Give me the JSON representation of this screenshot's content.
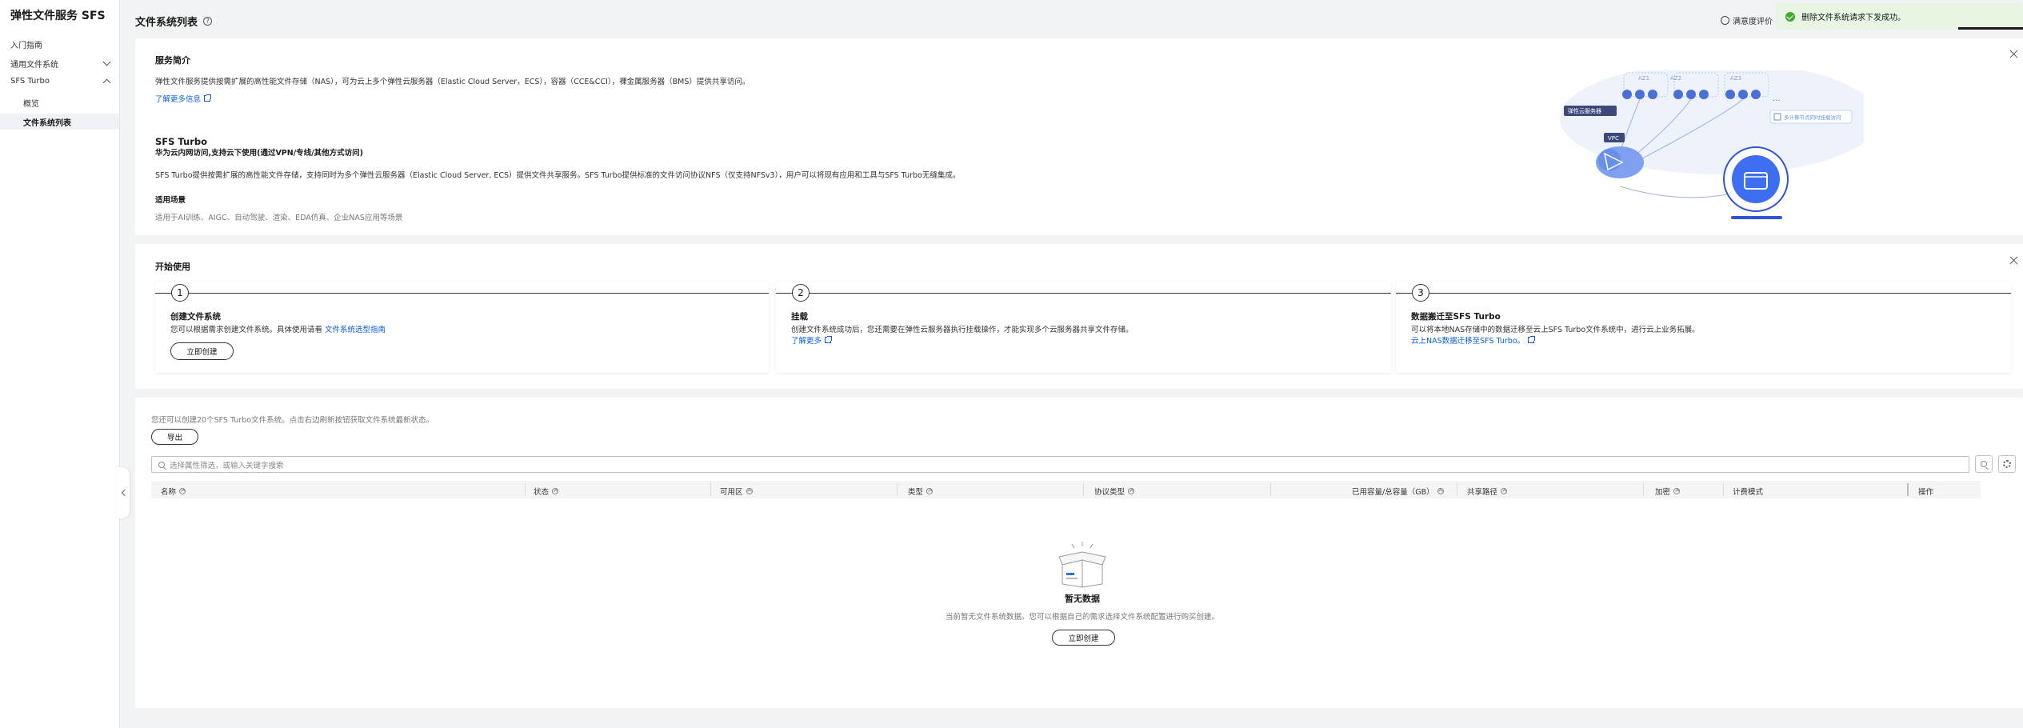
{
  "sidebar": {
    "service_title": "弹性文件服务 SFS",
    "items": [
      {
        "label": "入门指南"
      },
      {
        "label": "通用文件系统"
      },
      {
        "label": "SFS Turbo"
      }
    ],
    "sub_items": [
      {
        "label": "概览"
      },
      {
        "label": "文件系统列表"
      }
    ]
  },
  "header": {
    "title": "文件系统列表",
    "help_glyph": "?",
    "feedback_label": "满意度评价",
    "toast_text": "删除文件系统请求下发成功。"
  },
  "intro": {
    "section_title": "服务简介",
    "description": "弹性文件服务提供按需扩展的高性能文件存储（NAS），可为云上多个弹性云服务器（Elastic Cloud Server，ECS），容器（CCE&CCI），裸金属服务器（BMS）提供共享访问。",
    "learn_more": "了解更多信息",
    "turbo_title": "SFS Turbo",
    "turbo_subtitle": "华为云内网访问,支持云下使用(通过VPN/专线/其他方式访问)",
    "turbo_desc": "SFS Turbo提供按需扩展的高性能文件存储，支持同时为多个弹性云服务器（Elastic Cloud Server, ECS）提供文件共享服务。SFS Turbo提供标准的文件访问协议NFS（仅支持NFSv3），用户可以将现有应用和工具与SFS Turbo无缝集成。",
    "scenario_title": "适用场景",
    "scenario_desc": "适用于AI训练、AIGC、自动驾驶、渲染、EDA仿真、企业NAS应用等场景",
    "illustration": {
      "az_labels": [
        "AZ1",
        "AZ2",
        "AZ3"
      ],
      "ecs_label": "弹性云服务器",
      "vpc_label": "VPC",
      "node_label": "多计算节点同时挂载访问",
      "ellipsis": "..."
    }
  },
  "getting_started": {
    "section_title": "开始使用",
    "steps": [
      {
        "num": "1",
        "title": "创建文件系统",
        "desc": "您可以根据需求创建文件系统。具体使用请看",
        "link": "文件系统选型指南",
        "button": "立即创建"
      },
      {
        "num": "2",
        "title": "挂载",
        "desc": "创建文件系统成功后，您还需要在弹性云服务器执行挂载操作，才能实现多个云服务器共享文件存储。",
        "link": "了解更多"
      },
      {
        "num": "3",
        "title": "数据搬迁至SFS Turbo",
        "desc": "可以将本地NAS存储中的数据迁移至云上SFS Turbo文件系统中，进行云上业务拓展。",
        "link": "云上NAS数据迁移至SFS Turbo。"
      }
    ]
  },
  "list": {
    "quota_text": "您还可以创建20个SFS Turbo文件系统。点击右边刷新按钮获取文件系统最新状态。",
    "export_label": "导出",
    "search_placeholder": "选择属性筛选，或输入关键字搜索",
    "columns": [
      "名称",
      "状态",
      "可用区",
      "类型",
      "协议类型",
      "已用容量/总容量（GB）",
      "共享路径",
      "加密",
      "计费模式",
      "操作"
    ],
    "empty_title": "暂无数据",
    "empty_desc": "当前暂无文件系统数据。您可以根据自己的需求选择文件系统配置进行购买创建。",
    "empty_button": "立即创建"
  },
  "colors": {
    "link": "#0a5fd9",
    "toast_bg": "#e8f5e3",
    "success": "#3fab33"
  }
}
